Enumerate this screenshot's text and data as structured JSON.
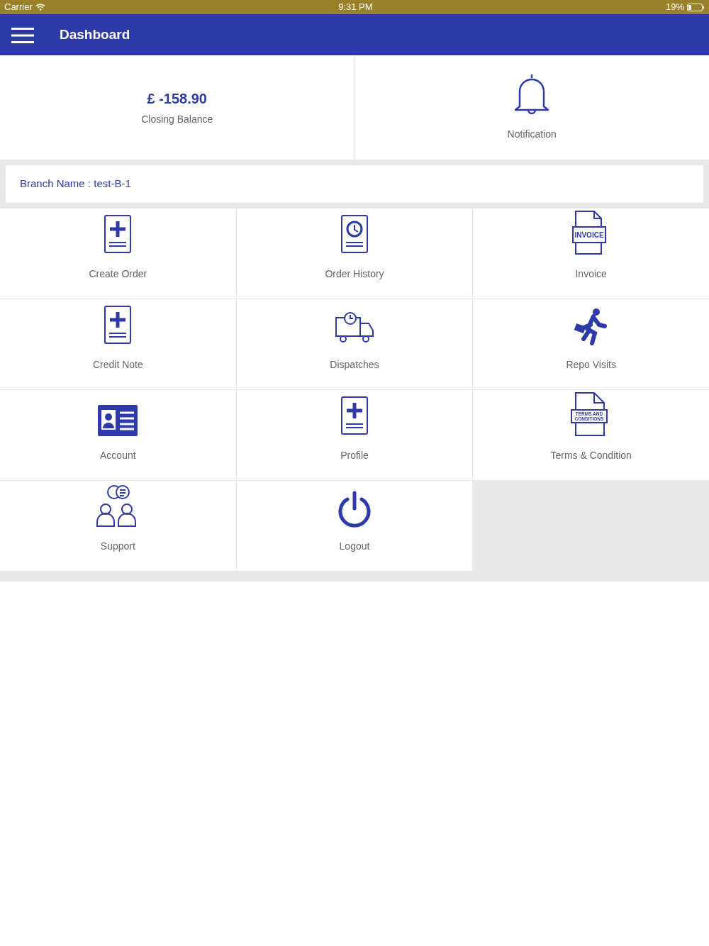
{
  "status_bar": {
    "carrier": "Carrier",
    "time": "9:31 PM",
    "battery": "19%"
  },
  "header": {
    "title": "Dashboard"
  },
  "summary": {
    "amount": "£ -158.90",
    "amount_label": "Closing Balance",
    "notification_label": "Notification"
  },
  "branch": {
    "text": "Branch Name : test-B-1"
  },
  "tiles": [
    {
      "label": "Create Order",
      "kind": "docplus"
    },
    {
      "label": "Order History",
      "kind": "history"
    },
    {
      "label": "Invoice",
      "kind": "invoice",
      "icon_text": [
        "INVOICE"
      ]
    },
    {
      "label": "Credit Note",
      "kind": "docplus"
    },
    {
      "label": "Dispatches",
      "kind": "truck"
    },
    {
      "label": "Repo Visits",
      "kind": "runner"
    },
    {
      "label": "Account",
      "kind": "card"
    },
    {
      "label": "Profile",
      "kind": "docplus"
    },
    {
      "label": "Terms & Condition",
      "kind": "terms",
      "icon_text": [
        "TERMS AND",
        "CONDITIONS"
      ]
    },
    {
      "label": "Support",
      "kind": "people"
    },
    {
      "label": "Logout",
      "kind": "power"
    }
  ]
}
